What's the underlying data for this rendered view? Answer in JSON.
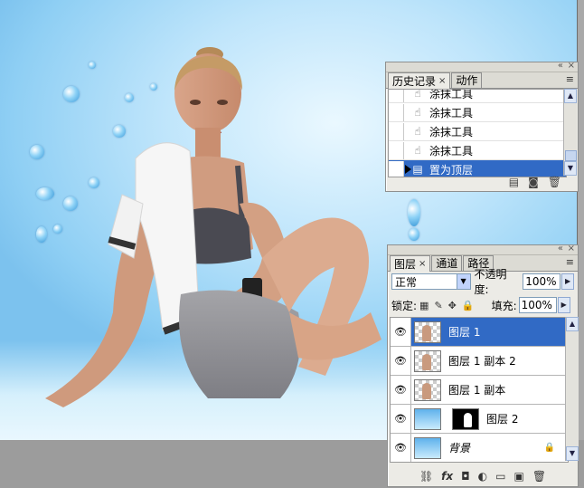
{
  "history_panel": {
    "tabs": [
      {
        "label": "历史记录",
        "close": "×"
      },
      {
        "label": "动作"
      }
    ],
    "menu_glyph": "≡",
    "items": [
      {
        "label": "涂抹工具",
        "icon": "smudge-tool-icon"
      },
      {
        "label": "涂抹工具",
        "icon": "smudge-tool-icon"
      },
      {
        "label": "涂抹工具",
        "icon": "smudge-tool-icon"
      },
      {
        "label": "涂抹工具",
        "icon": "smudge-tool-icon"
      },
      {
        "label": "置为顶层",
        "icon": "layer-order-icon",
        "selected": true
      }
    ],
    "footer_icons": [
      "new-document-from-state-icon",
      "new-snapshot-icon",
      "delete-icon"
    ]
  },
  "layers_panel": {
    "tabs": [
      {
        "label": "图层",
        "close": "×"
      },
      {
        "label": "通道"
      },
      {
        "label": "路径"
      }
    ],
    "menu_glyph": "≡",
    "blend_mode": "正常",
    "opacity_label": "不透明度:",
    "opacity_value": "100%",
    "lock_label": "锁定:",
    "fill_label": "填充:",
    "fill_value": "100%",
    "layers": [
      {
        "name": "图层 1",
        "thumb": "checker-figure",
        "selected": true
      },
      {
        "name": "图层 1 副本 2",
        "thumb": "checker-figure"
      },
      {
        "name": "图层 1 副本",
        "thumb": "checker-figure"
      },
      {
        "name": "图层 2",
        "thumb": "sky",
        "has_mask": true
      },
      {
        "name": "背景",
        "thumb": "sky",
        "locked": true
      }
    ],
    "footer_icons": [
      "link-layers-icon",
      "fx-icon",
      "add-mask-icon",
      "adjustment-layer-icon",
      "new-group-icon",
      "new-layer-icon",
      "delete-layer-icon"
    ]
  },
  "colors": {
    "selection": "#316ac5",
    "panel_bg": "#ecebe6",
    "workspace": "#9c9c9c"
  }
}
